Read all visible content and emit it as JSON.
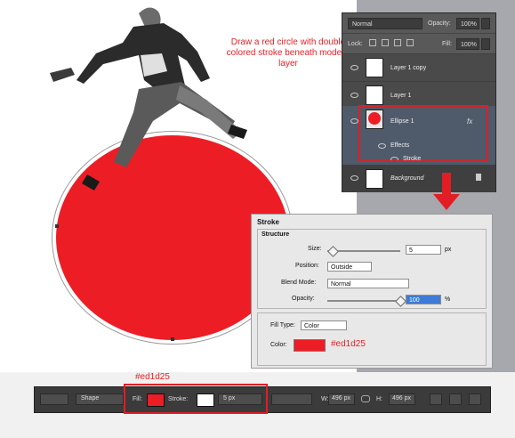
{
  "annotation": {
    "instruction": "Draw a red circle with double colored stroke beneath model's layer",
    "fill_hex_dialog": "#ed1d25",
    "fill_hex_toolbar": "#ed1d25"
  },
  "colors": {
    "fill": "#ed1d25",
    "highlight": "#e31d24"
  },
  "layers_panel": {
    "blend_mode": "Normal",
    "opacity_label": "Opacity:",
    "opacity_value": "100%",
    "lock_label": "Lock:",
    "fill_label": "Fill:",
    "fill_value": "100%",
    "layers": [
      {
        "name": "Layer 1 copy"
      },
      {
        "name": "Layer 1"
      },
      {
        "name": "Ellipse 1",
        "fx": "fx"
      },
      {
        "name": "Background"
      }
    ],
    "effects_label": "Effects",
    "stroke_label": "Stroke"
  },
  "stroke_dialog": {
    "title": "Stroke",
    "structure_label": "Structure",
    "size_label": "Size:",
    "size_value": "5",
    "size_unit": "px",
    "position_label": "Position:",
    "position_value": "Outside",
    "blend_label": "Blend Mode:",
    "blend_value": "Normal",
    "opacity_label": "Opacity:",
    "opacity_value": "100",
    "opacity_unit": "%",
    "filltype_label": "Fill Type:",
    "filltype_value": "Color",
    "color_label": "Color:"
  },
  "options_bar": {
    "mode": "Shape",
    "fill_label": "Fill:",
    "stroke_label": "Stroke:",
    "stroke_size": "5 px",
    "w_label": "W:",
    "w_value": "496 px",
    "h_label": "H:",
    "h_value": "496 px"
  }
}
